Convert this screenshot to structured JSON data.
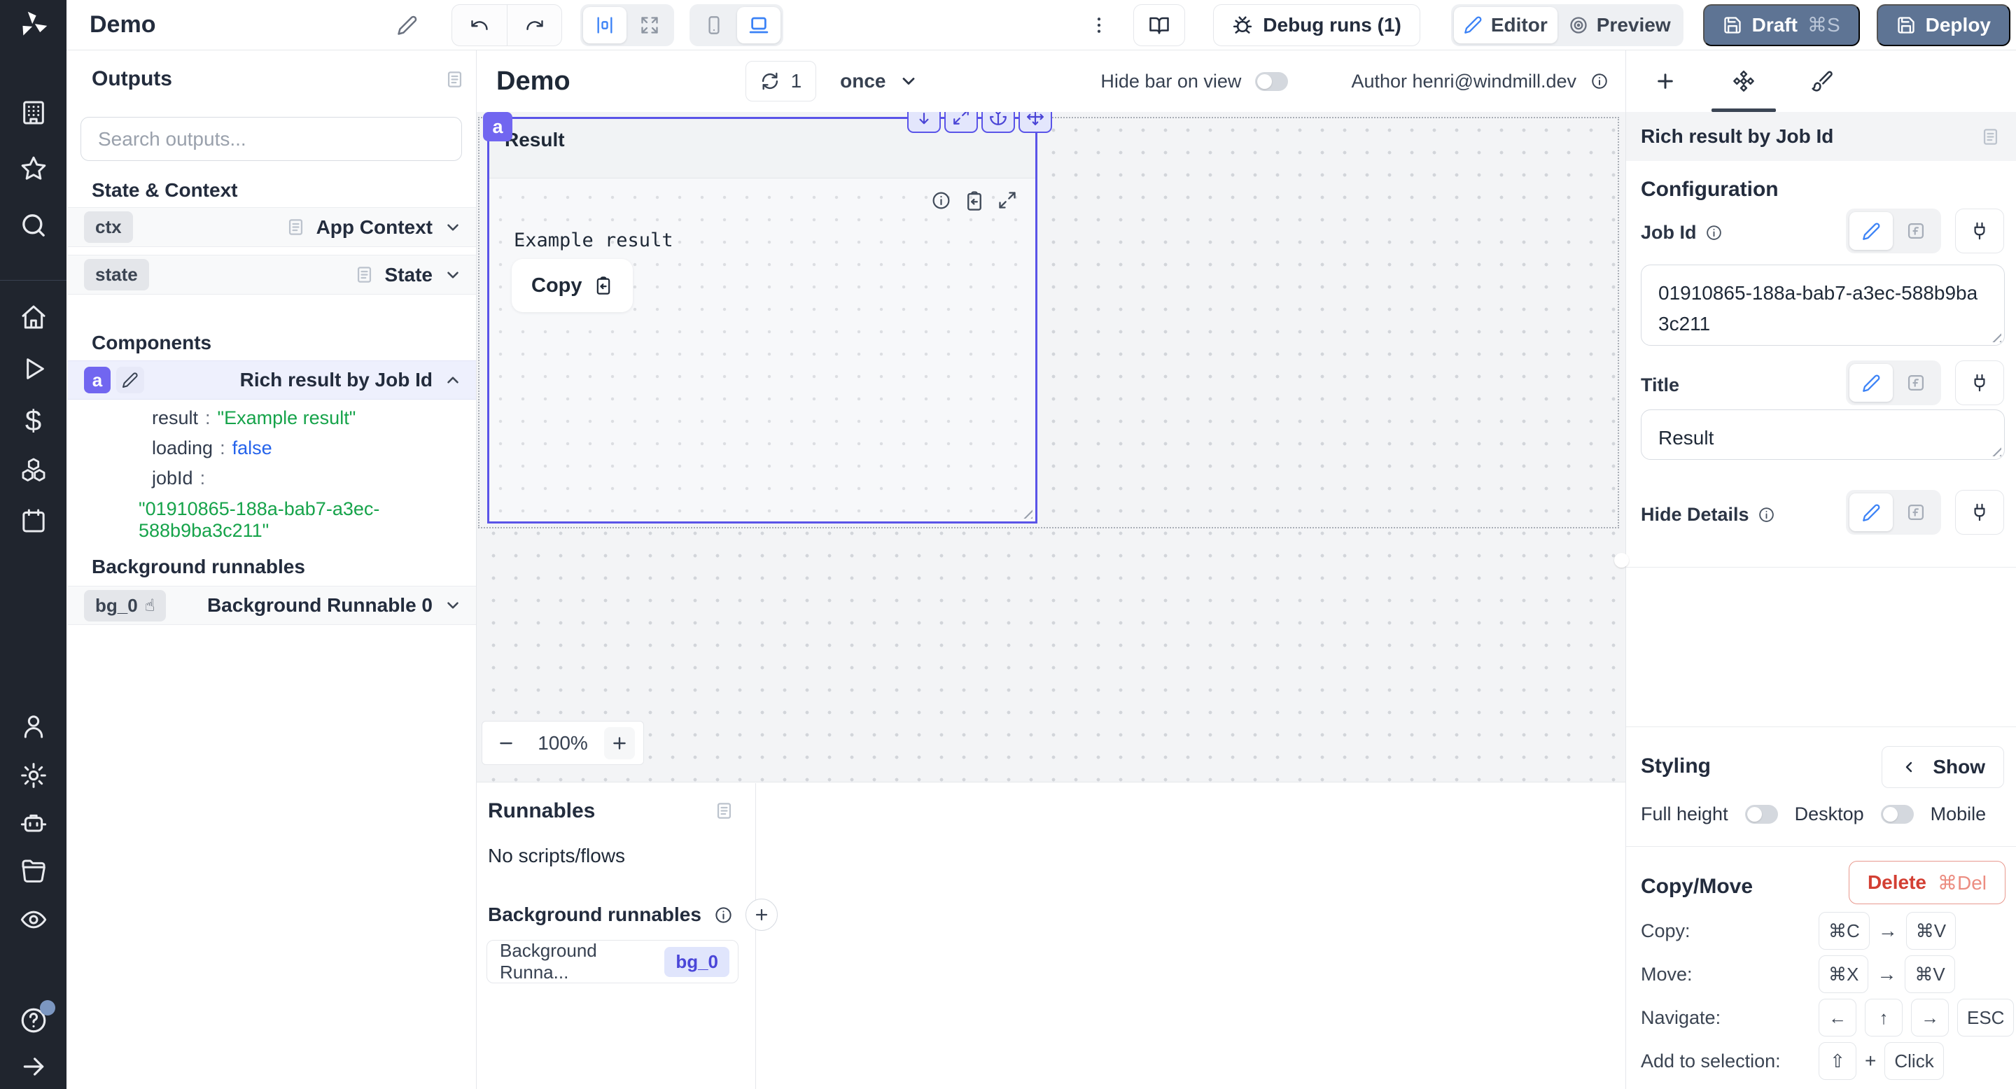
{
  "colors": {
    "accent_indigo": "#6366f1",
    "badge_indigo": "#7166f0",
    "selection_bg": "#eef0fd",
    "slate_button": "#5e7494",
    "sidebar_bg": "#20252e",
    "canvas_bg": "#f3f4f6",
    "json_string_green": "#16a34a",
    "json_bool_blue": "#2563eb",
    "delete_red": "#d33f33",
    "active_blue": "#3b82f6"
  },
  "icons": {
    "windmill-logo": "pinwheel",
    "pencil": "✎",
    "undo": "↩",
    "redo": "↪",
    "align-center": "|0|",
    "maximize": "⤢",
    "phone": "▯",
    "laptop": "▭",
    "kebab": "⋮",
    "book": "📖",
    "bug": "bug",
    "preview": "◎",
    "save": "💾",
    "doc": "▤",
    "search": "🔍",
    "chevron": "⌄",
    "hand-pointer": "☝",
    "info": "ⓘ",
    "clipboard": "📋",
    "plug": "plug",
    "anchor": "⚓",
    "move": "✥",
    "fn": "[f]",
    "brush": "🖌",
    "diamond-grid": "❖",
    "plus": "+"
  },
  "topbar": {
    "app_title": "Demo",
    "debug_runs_label": "Debug runs (1)",
    "editor_label": "Editor",
    "preview_label": "Preview",
    "draft_label": "Draft",
    "draft_shortcut": "⌘S",
    "deploy_label": "Deploy"
  },
  "outputs_panel": {
    "title": "Outputs",
    "search_placeholder": "Search outputs...",
    "state_context_heading": "State & Context",
    "ctx_badge": "ctx",
    "ctx_label": "App Context",
    "state_badge": "state",
    "state_label": "State",
    "components_heading": "Components",
    "component_badge": "a",
    "component_label": "Rich result by Job Id",
    "json": {
      "result_key": "result",
      "result_value": "\"Example result\"",
      "loading_key": "loading",
      "loading_value": "false",
      "jobid_key": "jobId",
      "jobid_value": "\"01910865-188a-bab7-a3ec-588b9ba3c211\""
    },
    "background_heading": "Background runnables",
    "bg_badge": "bg_0",
    "bg_label": "Background Runnable 0"
  },
  "canvas": {
    "title": "Demo",
    "refresh_count": "1",
    "schedule": "once",
    "hide_bar_label": "Hide bar on view",
    "author_label": "Author henri@windmill.dev",
    "component_badge": "a",
    "component_title": "Result",
    "component_result": "Example result",
    "copy_button": "Copy",
    "zoom_level": "100%"
  },
  "runnables_panel": {
    "title": "Runnables",
    "empty": "No scripts/flows",
    "background_heading": "Background runnables",
    "item_label": "Background Runna...",
    "item_badge": "bg_0"
  },
  "settings_panel": {
    "component_title": "Rich result by Job Id",
    "configuration_heading": "Configuration",
    "job_id_label": "Job Id",
    "job_id_value": "01910865-188a-bab7-a3ec-588b9ba3c211",
    "title_label": "Title",
    "title_value": "Result",
    "hide_details_label": "Hide Details",
    "styling_heading": "Styling",
    "show_button": "Show",
    "full_height_label": "Full height",
    "desktop_label": "Desktop",
    "mobile_label": "Mobile",
    "copy_move_heading": "Copy/Move",
    "delete_label": "Delete",
    "delete_shortcut": "⌘Del",
    "shortcuts": {
      "copy_label": "Copy:",
      "copy_keys": [
        "⌘C",
        "⌘V"
      ],
      "move_label": "Move:",
      "move_keys": [
        "⌘X",
        "⌘V"
      ],
      "navigate_label": "Navigate:",
      "nav_keys": [
        "←",
        "↑",
        "→",
        "ESC"
      ],
      "selection_label": "Add to selection:",
      "sel_keys": [
        "⇧",
        "Click"
      ],
      "arrow_sep": "→",
      "plus_sep": "+"
    }
  }
}
